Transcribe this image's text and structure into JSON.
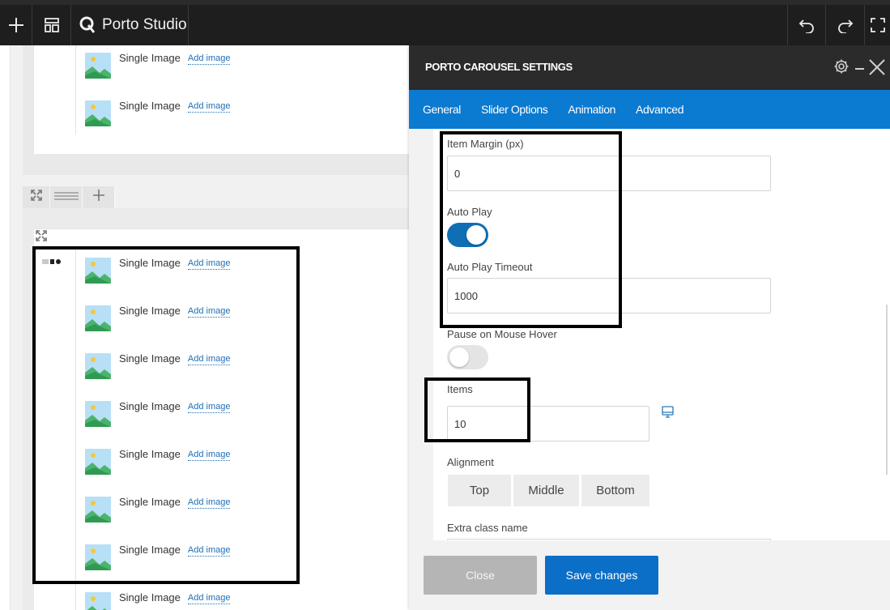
{
  "toolbar": {
    "brand": "Porto Studio",
    "icons": {
      "add": "plus-icon",
      "layout": "layout-icon",
      "brand": "porto-logo-icon",
      "undo": "undo-icon",
      "redo": "redo-icon",
      "fullscreen": "fullscreen-icon"
    }
  },
  "builder": {
    "top_items": [
      {
        "label": "Single Image",
        "action": "Add image"
      },
      {
        "label": "Single Image",
        "action": "Add image"
      }
    ],
    "row_controls": [
      "expand-icon",
      "menu-icon",
      "plus-icon"
    ],
    "bottom_items": [
      {
        "label": "Single Image",
        "action": "Add image"
      },
      {
        "label": "Single Image",
        "action": "Add image"
      },
      {
        "label": "Single Image",
        "action": "Add image"
      },
      {
        "label": "Single Image",
        "action": "Add image"
      },
      {
        "label": "Single Image",
        "action": "Add image"
      },
      {
        "label": "Single Image",
        "action": "Add image"
      },
      {
        "label": "Single Image",
        "action": "Add image"
      },
      {
        "label": "Single Image",
        "action": "Add image"
      }
    ]
  },
  "modal": {
    "title": "PORTO CAROUSEL SETTINGS",
    "tabs": [
      {
        "label": "General",
        "active": true
      },
      {
        "label": "Slider Options",
        "active": false
      },
      {
        "label": "Animation",
        "active": false
      },
      {
        "label": "Advanced",
        "active": false
      }
    ],
    "fields": {
      "item_margin": {
        "label": "Item Margin (px)",
        "value": "0"
      },
      "auto_play": {
        "label": "Auto Play",
        "on": true
      },
      "auto_play_timeout": {
        "label": "Auto Play Timeout",
        "value": "1000"
      },
      "pause_on_hover": {
        "label": "Pause on Mouse Hover",
        "on": false
      },
      "items": {
        "label": "Items",
        "value": "10"
      },
      "alignment": {
        "label": "Alignment",
        "options": [
          "Top",
          "Middle",
          "Bottom"
        ]
      },
      "extra_class": {
        "label": "Extra class name"
      }
    },
    "buttons": {
      "close": "Close",
      "save": "Save changes"
    }
  },
  "colors": {
    "header": "#2b2b2b",
    "tabs": "#0b7ad1",
    "toggle_on": "#0e6fb4",
    "save": "#0b6fc8",
    "close": "#b5b5b5"
  }
}
